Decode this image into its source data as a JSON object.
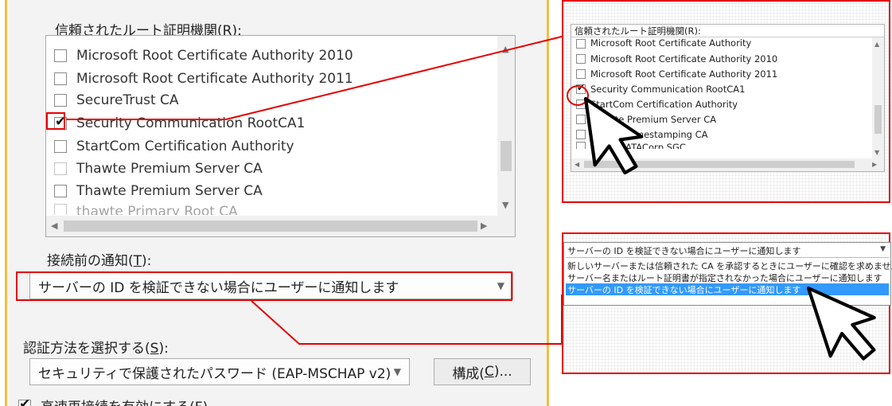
{
  "trusted_root_label": "信頼されたルート証明機関(",
  "trusted_root_key": "R",
  "trusted_root_suffix": "):",
  "cert_items": [
    {
      "label": "Microsoft Root Certificate Authority 2010",
      "checked": false
    },
    {
      "label": "Microsoft Root Certificate Authority 2011",
      "checked": false
    },
    {
      "label": "SecureTrust CA",
      "checked": false
    },
    {
      "label": "Security Communication RootCA1",
      "checked": true
    },
    {
      "label": "StartCom Certification Authority",
      "checked": false
    },
    {
      "label": "Thawte Premium Server CA",
      "checked": false
    },
    {
      "label": "Thawte Premium Server CA",
      "checked": false
    },
    {
      "label": "thawte Primary Root CA",
      "checked": false
    }
  ],
  "notify_label": "接続前の通知(",
  "notify_key": "T",
  "notify_suffix": "):",
  "notify_value": "サーバーの ID を検証できない場合にユーザーに通知します",
  "auth_label": "認証方法を選択する(",
  "auth_key": "S",
  "auth_suffix": "):",
  "auth_value": "セキュリティで保護されたパスワード (EAP-MSCHAP v2)",
  "configure_label": "構成(",
  "configure_key": "C",
  "configure_suffix": ")...",
  "fast_reconnect_label": "高速再接続を有効にする(F)",
  "callout_top": {
    "title": "信頼されたルート証明機関(R):",
    "items": [
      {
        "label": "Microsoft Root Certificate Authority",
        "checked": false
      },
      {
        "label": "Microsoft Root Certificate Authority 2010",
        "checked": false
      },
      {
        "label": "Microsoft Root Certificate Authority 2011",
        "checked": false
      },
      {
        "label": "Security Communication RootCA1",
        "checked": true
      },
      {
        "label": "StartCom Certification Authority",
        "checked": false
      },
      {
        "label": "Thawte Premium Server CA",
        "checked": false
      },
      {
        "label": "Thawte Timestamping CA",
        "checked": false
      },
      {
        "label": "UTN - DATACorp SGC",
        "checked": false
      }
    ]
  },
  "callout_bottom": {
    "selected": "サーバーの ID を検証できない場合にユーザーに通知します",
    "options": [
      "新しいサーバーまたは信頼された CA を承認するときにユーザーに確認を求めません",
      "サーバー名またはルート証明書が指定されなかった場合にユーザーに通知します",
      "サーバーの ID を検証できない場合にユーザーに通知します"
    ],
    "highlighted_index": 2
  },
  "colors": {
    "highlight": "#e60000",
    "selection": "#3399ff",
    "dialog_bg": "#f3f3f3",
    "frame": "#f0c040"
  }
}
